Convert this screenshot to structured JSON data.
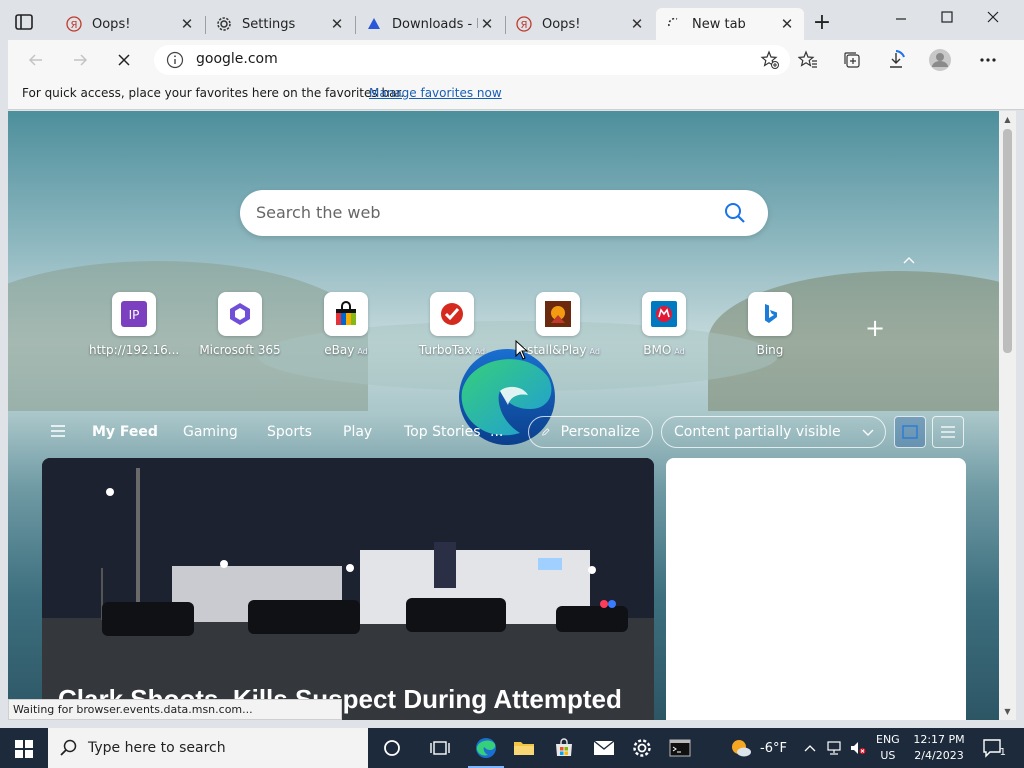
{
  "browser": {
    "tabs": [
      {
        "title": "Oops!",
        "icon": "yandex-icon"
      },
      {
        "title": "Settings",
        "icon": "gear-icon"
      },
      {
        "title": "Downloads - Bo",
        "icon": "downloads-site-icon"
      },
      {
        "title": "Oops!",
        "icon": "yandex-icon"
      },
      {
        "title": "New tab",
        "icon": "loading-spinner-icon",
        "active": true
      }
    ],
    "address": "google.com"
  },
  "favorites_bar": {
    "message": "For quick access, place your favorites here on the favorites bar.",
    "link": "Manage favorites now"
  },
  "newtab": {
    "search_placeholder": "Search the web",
    "quick_links": [
      {
        "label": "http://192.16...",
        "ad": ""
      },
      {
        "label": "Microsoft 365",
        "ad": ""
      },
      {
        "label": "eBay",
        "ad": "Ad"
      },
      {
        "label": "TurboTax",
        "ad": "Ad"
      },
      {
        "label": "Install&Play",
        "ad": "Ad"
      },
      {
        "label": "BMO",
        "ad": "Ad"
      },
      {
        "label": "Bing",
        "ad": ""
      }
    ],
    "feed_nav": {
      "items": [
        "My Feed",
        "Gaming",
        "Sports",
        "Play",
        "Top Stories",
        "..."
      ],
      "personalize": "Personalize",
      "content_visibility": "Content partially visible"
    },
    "headline": "Clark Shoots, Kills Suspect During Attempted"
  },
  "status_bar": "Waiting for browser.events.data.msn.com...",
  "taskbar": {
    "search_placeholder": "Type here to search",
    "weather": "-6°F",
    "lang_top": "ENG",
    "lang_bottom": "US",
    "time": "12:17 PM",
    "date": "2/4/2023",
    "notification_count": "1"
  },
  "colors": {
    "accent_link": "#1a5fb4",
    "taskbar": "#1c2a3b",
    "chrome": "#dfe3e8"
  }
}
